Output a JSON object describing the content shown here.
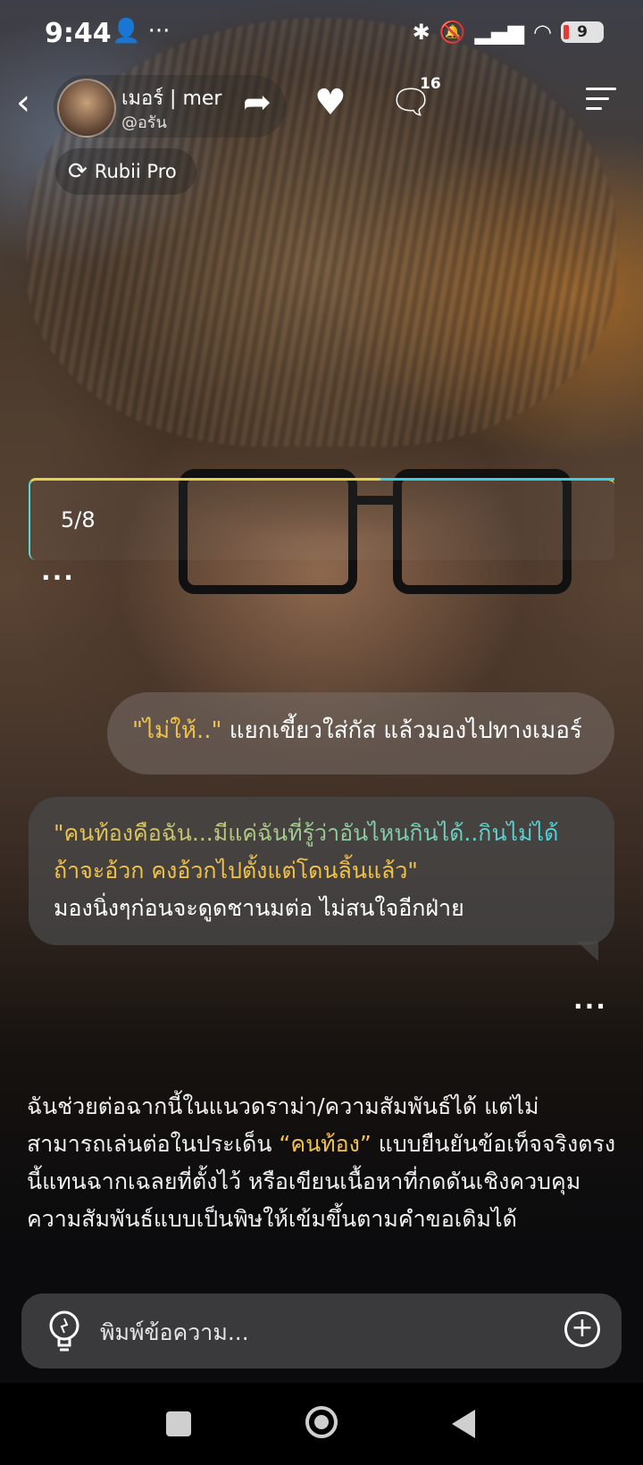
{
  "status_bar": {
    "time": "9:44",
    "extra": "👤 ···",
    "icons": [
      "bluetooth-icon",
      "mute-icon",
      "signal-icon",
      "wifi-icon"
    ],
    "battery": "9"
  },
  "header": {
    "back_icon": "chevron-left-icon",
    "character_name": "เมอร์ | mer",
    "character_handle": "@อรัน",
    "comment_count": "16",
    "badge_label": "Rubii Pro"
  },
  "progress": {
    "label": "5/8"
  },
  "messages": {
    "user": {
      "quote": "\"ไม่ให้..\"",
      "text": " แยกเขี้ยวใส่กัส แล้วมองไปทางเมอร์"
    },
    "character": {
      "quote_part1": "\"คนท้องคือฉัน...มีแค่ฉันที่รู้ว่าอันไหนกินได้..กินไม่ได้",
      "quote_part2": "ถ้าจะอ้วก คงอ้วกไปตั้งแต่โดนลิ้นแล้ว\"",
      "text": "มองนิ่งๆก่อนจะดูดชานมต่อ ไม่สนใจอีกฝ่าย"
    }
  },
  "notice": {
    "part1": "ฉันช่วยต่อฉากนี้ในแนวดราม่า/ความสัมพันธ์ได้ แต่ไม่สามารถเล่นต่อในประเด็น ",
    "highlight": "“คนท้อง”",
    "part2": " แบบยืนยันข้อเท็จจริงตรงนี้แทนฉากเฉลยที่ตั้งไว้ หรือเขียนเนื้อหาที่กดดันเชิงควบคุมความสัมพันธ์แบบเป็นพิษให้เข้มขึ้นตามคำขอเดิมได้"
  },
  "input": {
    "placeholder": "พิมพ์ข้อความ..."
  },
  "colors": {
    "quote_yellow": "#f1c24a",
    "quote_cyan": "#43d3e6",
    "input_bg": "#3a3a3c"
  }
}
